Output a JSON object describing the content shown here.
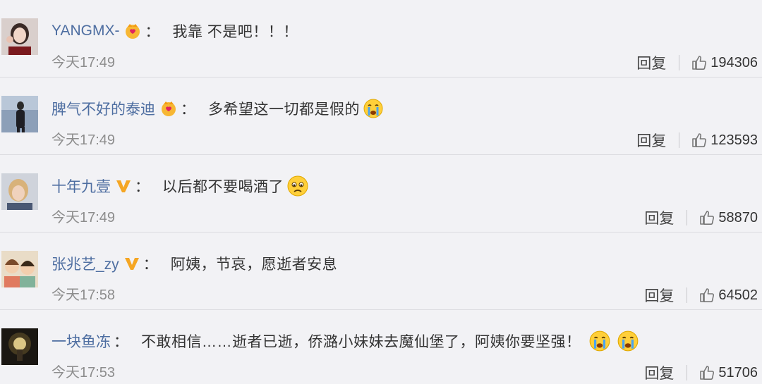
{
  "comments": [
    {
      "user": "YANGMX-",
      "badge": "crown-heart",
      "colon": "：",
      "text": "我靠 不是吧！！！",
      "emojis": [],
      "time": "今天17:49",
      "reply": "回复",
      "likes": "194306"
    },
    {
      "user": "脾气不好的泰迪",
      "badge": "crown-heart",
      "colon": "：",
      "text": "多希望这一切都是假的",
      "emojis": [
        "crying-emoji"
      ],
      "time": "今天17:49",
      "reply": "回复",
      "likes": "123593"
    },
    {
      "user": "十年九壹",
      "badge": "vip-v",
      "colon": "：",
      "text": "以后都不要喝酒了",
      "emojis": [
        "sad-emoji"
      ],
      "time": "今天17:49",
      "reply": "回复",
      "likes": "58870"
    },
    {
      "user": "张兆艺_zy",
      "badge": "vip-v",
      "colon": "：",
      "text": "阿姨，节哀，愿逝者安息",
      "emojis": [],
      "time": "今天17:58",
      "reply": "回复",
      "likes": "64502"
    },
    {
      "user": "一块鱼冻",
      "badge": "",
      "colon": "：",
      "text": "不敢相信……逝者已逝，侨潞小妹妹去魔仙堡了，阿姨你要坚强！",
      "emojis": [
        "crying-emoji",
        "crying-emoji"
      ],
      "time": "今天17:53",
      "reply": "回复",
      "likes": "51706"
    }
  ],
  "colors": {
    "username": "#4e6ea1",
    "time": "#8d8d8d",
    "background": "#f2f2f5",
    "vip": "#f5a623"
  }
}
